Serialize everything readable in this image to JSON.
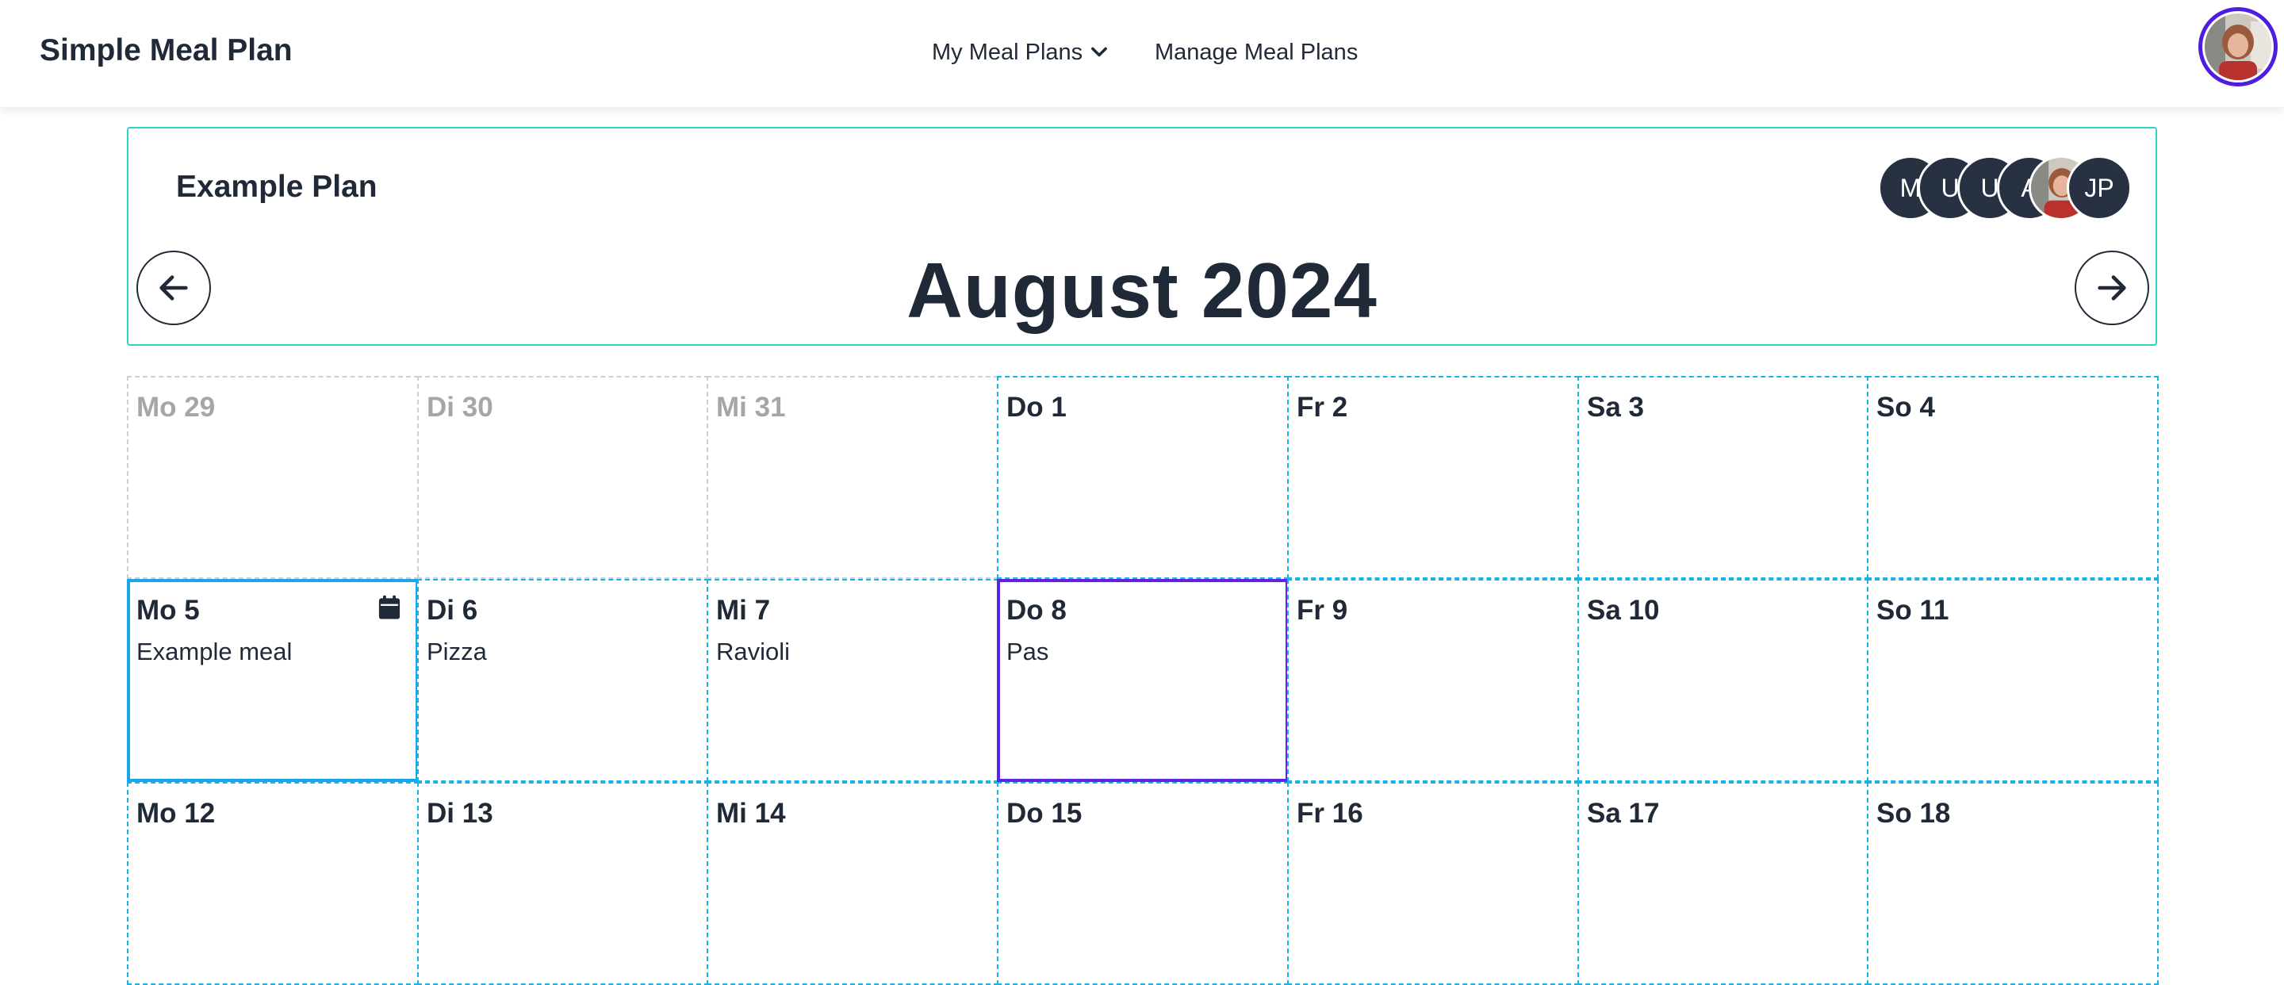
{
  "app": {
    "brand": "Simple Meal Plan"
  },
  "nav": {
    "my_meal_plans": "My Meal Plans",
    "manage_meal_plans": "Manage Meal Plans"
  },
  "plan": {
    "name": "Example Plan",
    "month_title": "August 2024",
    "members": [
      "M",
      "U",
      "U",
      "A",
      "",
      "JP"
    ]
  },
  "calendar": {
    "weeks": [
      [
        {
          "label": "Mo 29",
          "meal": "",
          "state": "faded"
        },
        {
          "label": "Di 30",
          "meal": "",
          "state": "faded"
        },
        {
          "label": "Mi 31",
          "meal": "",
          "state": "faded"
        },
        {
          "label": "Do 1",
          "meal": "",
          "state": "normal"
        },
        {
          "label": "Fr 2",
          "meal": "",
          "state": "normal"
        },
        {
          "label": "Sa 3",
          "meal": "",
          "state": "normal"
        },
        {
          "label": "So 4",
          "meal": "",
          "state": "normal"
        }
      ],
      [
        {
          "label": "Mo 5",
          "meal": "Example meal",
          "state": "today"
        },
        {
          "label": "Di 6",
          "meal": "Pizza",
          "state": "normal"
        },
        {
          "label": "Mi 7",
          "meal": "Ravioli",
          "state": "normal"
        },
        {
          "label": "Do 8",
          "meal": "Pas",
          "state": "selected"
        },
        {
          "label": "Fr 9",
          "meal": "",
          "state": "normal"
        },
        {
          "label": "Sa 10",
          "meal": "",
          "state": "normal"
        },
        {
          "label": "So 11",
          "meal": "",
          "state": "normal"
        }
      ],
      [
        {
          "label": "Mo 12",
          "meal": "",
          "state": "normal"
        },
        {
          "label": "Di 13",
          "meal": "",
          "state": "normal"
        },
        {
          "label": "Mi 14",
          "meal": "",
          "state": "normal"
        },
        {
          "label": "Do 15",
          "meal": "",
          "state": "normal"
        },
        {
          "label": "Fr 16",
          "meal": "",
          "state": "normal"
        },
        {
          "label": "Sa 17",
          "meal": "",
          "state": "normal"
        },
        {
          "label": "So 18",
          "meal": "",
          "state": "normal"
        }
      ]
    ]
  },
  "icons": {
    "dropdown": "chevron-down-icon",
    "prev": "arrow-left-icon",
    "next": "arrow-right-icon",
    "today": "calendar-icon"
  },
  "colors": {
    "plan_border": "#2dd4bf",
    "day_border": "#16b4ea",
    "today_border": "#1aa6ea",
    "selected_border": "#5b24e6",
    "avatar_ring": "#4f1de0",
    "dark_text": "#1f2937",
    "faded_text": "#a6a6a6"
  }
}
